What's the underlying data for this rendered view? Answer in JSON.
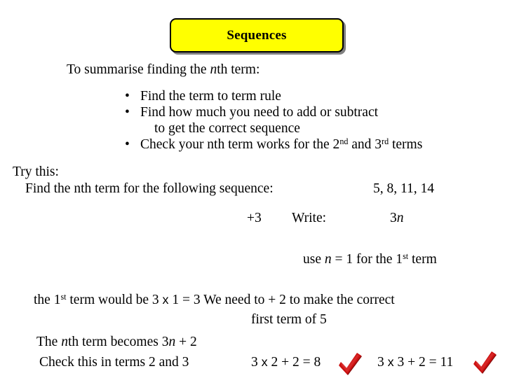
{
  "slide": {
    "title": "Sequences",
    "title_bg_color": "#ffff00",
    "title_border_color": "#000000",
    "tick_color": "#cc1111",
    "tick_shadow_color": "#8a0c0c",
    "summary_intro_pre": "To summarise finding the ",
    "summary_intro_n": "n",
    "summary_intro_post": "th term:",
    "bullets": [
      {
        "marker": "•",
        "text": "Find the term to term rule"
      },
      {
        "marker": "•",
        "text": "Find how much you need to add or subtract"
      },
      {
        "marker": "",
        "text": "to get the correct sequence"
      },
      {
        "marker": "•",
        "text_pre": "Check your nth term works for the 2",
        "sup_1": "nd",
        "text_mid": " and 3",
        "sup_2": "rd",
        "text_post": " terms"
      }
    ],
    "try_this_label": "Try this:",
    "find_nth_prompt": "Find the nth term for the following sequence:",
    "sequence_values": "5, 8, 11, 14",
    "term_to_term": "+3",
    "write_label": "Write:",
    "expression_coefficient": "3",
    "expression_variable": "n",
    "use_n_pre": "use ",
    "use_n_var": "n",
    "use_n_mid": " = 1 for the 1",
    "use_n_sup": "st",
    "use_n_post": " term",
    "first_term_pre": "the 1",
    "first_term_sup": "st",
    "first_term_mid": " term would be 3 ",
    "first_term_times": "x",
    "first_term_post": " 1 = 3 We need to + 2 to make the correct",
    "first_term_of_5": "first term of 5",
    "nth_becomes_pre": "The ",
    "nth_becomes_n1": "n",
    "nth_becomes_mid": "th term becomes 3",
    "nth_becomes_n2": "n",
    "nth_becomes_post": " + 2",
    "check_terms_label": "Check this in terms 2 and 3",
    "check_calc_1_a": "3 ",
    "check_calc_1_times": "x",
    "check_calc_1_b": " 2 + 2 = 8",
    "check_calc_2_a": "3 ",
    "check_calc_2_times": "x",
    "check_calc_2_b": " 3 + 2 = 11",
    "tick_1_name": "red-check-mark-term-2",
    "tick_2_name": "red-check-mark-term-3"
  }
}
